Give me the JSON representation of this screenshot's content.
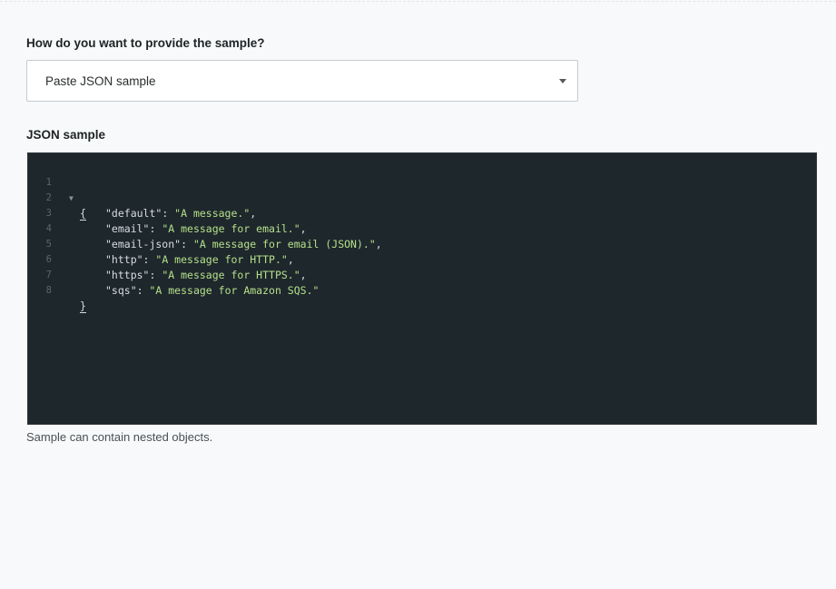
{
  "form": {
    "source_label": "How do you want to provide the sample?",
    "source_select": {
      "value": "Paste JSON sample"
    },
    "sample_label": "JSON sample",
    "hint": "Sample can contain nested objects."
  },
  "editor": {
    "lines": [
      {
        "num": "1",
        "open": "{"
      },
      {
        "num": "2",
        "key": "\"default\"",
        "sep": ": ",
        "value": "\"A message.\"",
        "end": ","
      },
      {
        "num": "3",
        "key": "\"email\"",
        "sep": ": ",
        "value": "\"A message for email.\"",
        "end": ","
      },
      {
        "num": "4",
        "key": "\"email-json\"",
        "sep": ": ",
        "value": "\"A message for email (JSON).\"",
        "end": ","
      },
      {
        "num": "5",
        "key": "\"http\"",
        "sep": ": ",
        "value": "\"A message for HTTP.\"",
        "end": ","
      },
      {
        "num": "6",
        "key": "\"https\"",
        "sep": ": ",
        "value": "\"A message for HTTPS.\"",
        "end": ","
      },
      {
        "num": "7",
        "key": "\"sqs\"",
        "sep": ": ",
        "value": "\"A message for Amazon SQS.\"",
        "end": ""
      },
      {
        "num": "8",
        "close": "}"
      }
    ],
    "fold_icon": "triangle-down",
    "colors": {
      "background": "#1e272c",
      "string": "#b5e08a",
      "text": "#d6dde0",
      "gutter": "#5b666c"
    }
  }
}
